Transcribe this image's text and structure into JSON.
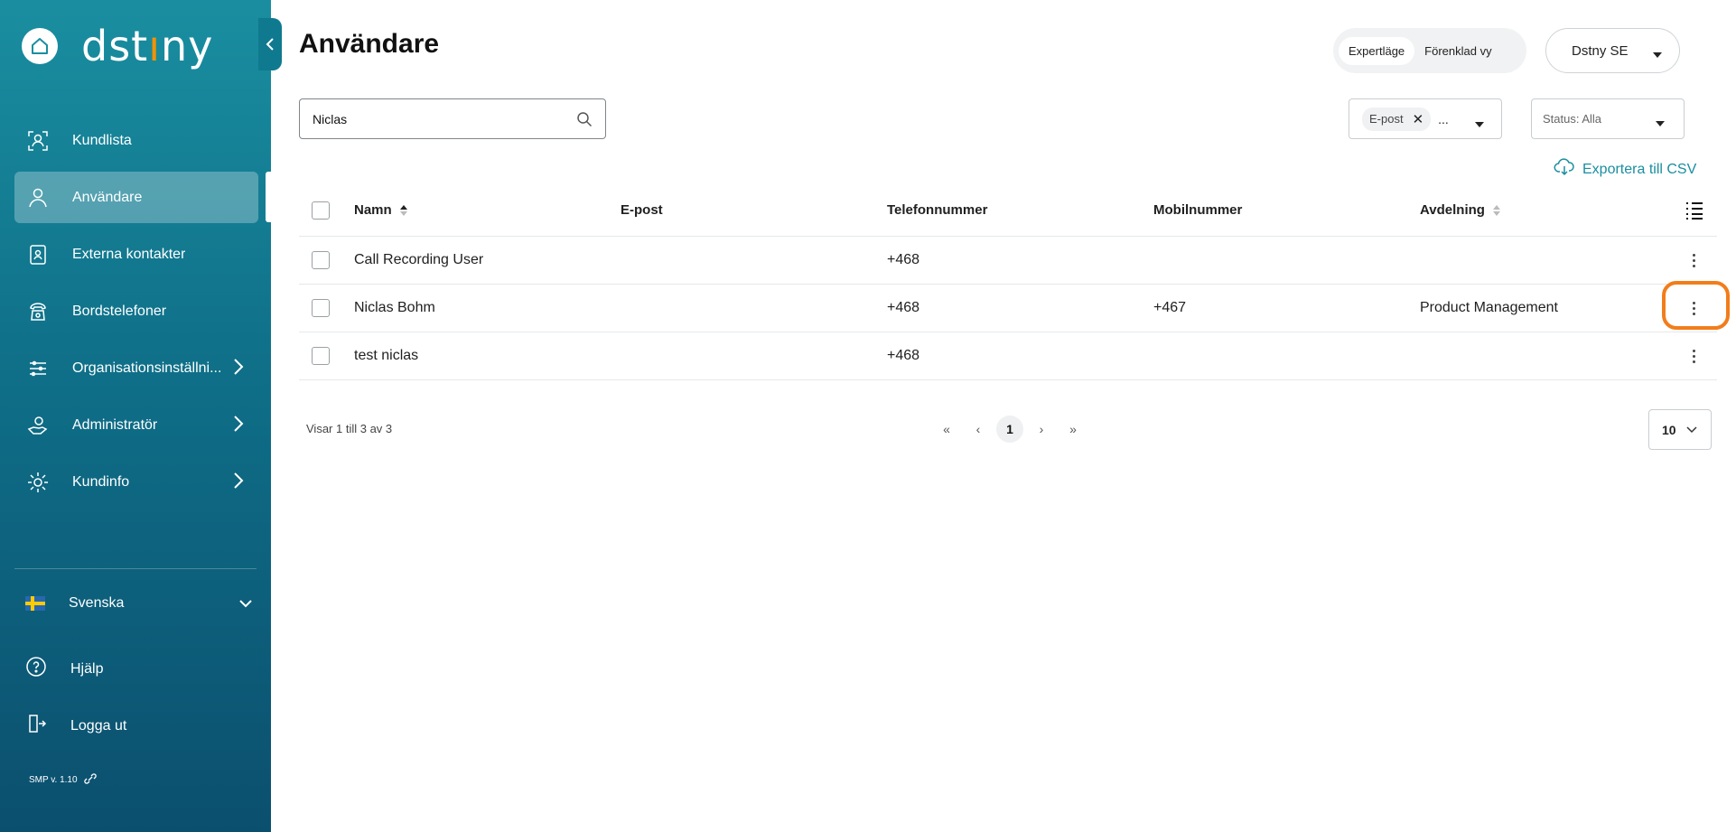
{
  "app": {
    "logo_text_a": "dst",
    "logo_text_dot": "ı",
    "logo_text_b": "ny",
    "brand_accent": "#f39200",
    "primary_color": "#1a8ea0"
  },
  "sidebar": {
    "items": [
      {
        "label": "Kundlista",
        "icon": "customer-list-icon",
        "active": false,
        "has_submenu": false
      },
      {
        "label": "Användare",
        "icon": "user-icon",
        "active": true,
        "has_submenu": false
      },
      {
        "label": "Externa kontakter",
        "icon": "contact-book-icon",
        "active": false,
        "has_submenu": false
      },
      {
        "label": "Bordstelefoner",
        "icon": "desk-phone-icon",
        "active": false,
        "has_submenu": false
      },
      {
        "label": "Organisationsinställni...",
        "icon": "sliders-icon",
        "active": false,
        "has_submenu": true
      },
      {
        "label": "Administratör",
        "icon": "admin-icon",
        "active": false,
        "has_submenu": true
      },
      {
        "label": "Kundinfo",
        "icon": "gear-icon",
        "active": false,
        "has_submenu": true
      }
    ],
    "language": "Svenska",
    "help": "Hjälp",
    "logout": "Logga ut",
    "version": "SMP v. 1.10"
  },
  "header": {
    "title": "Användare",
    "mode_options": [
      "Expertläge",
      "Förenklad vy"
    ],
    "mode_selected": "Expertläge",
    "tenant": "Dstny SE"
  },
  "filters": {
    "search_value": "Niclas",
    "field_chip": "E-post",
    "field_more": "...",
    "status": "Status: Alla",
    "export_label": "Exportera till CSV"
  },
  "table": {
    "columns": [
      "Namn",
      "E-post",
      "Telefonnummer",
      "Mobilnummer",
      "Avdelning"
    ],
    "rows": [
      {
        "name": "Call Recording User",
        "email": "",
        "phone": "+468",
        "mobile": "",
        "department": ""
      },
      {
        "name": "Niclas Bohm",
        "email": "",
        "phone": "+468",
        "mobile": "+467",
        "department": "Product Management"
      },
      {
        "name": "test niclas",
        "email": "",
        "phone": "+468",
        "mobile": "",
        "department": ""
      }
    ]
  },
  "pagination": {
    "showing": "Visar 1 till 3 av 3",
    "current_page": "1",
    "page_size": "10"
  },
  "highlight_color": "#f27d1a"
}
